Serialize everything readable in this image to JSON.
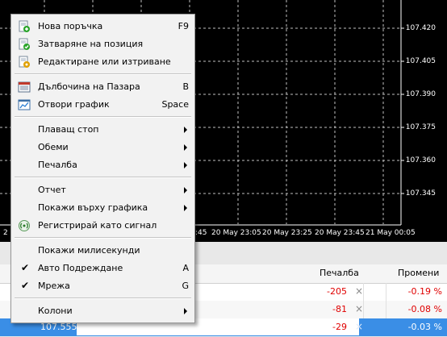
{
  "chart": {
    "prices": [
      "107.420",
      "107.405",
      "107.390",
      "107.375",
      "107.360",
      "107.345"
    ],
    "times": [
      "20 May 22:45",
      "20 May 23:05",
      "20 May 23:25",
      "20 May 23:45",
      "21 May 00:05"
    ],
    "time_prefix_fragments": [
      "2",
      ":45"
    ],
    "colors": {
      "background": "#000000",
      "grid": "#c0c0c0",
      "text": "#ffffff"
    }
  },
  "terminal": {
    "headers": {
      "profit": "Печалба",
      "change": "Промени"
    },
    "rows": [
      {
        "profit": "-205",
        "change": "-0.19 %",
        "price": ""
      },
      {
        "profit": "-81",
        "change": "-0.08 %",
        "price": ""
      },
      {
        "profit": "-29",
        "change": "-0.03 %",
        "price": "107.555"
      }
    ],
    "close_glyph": "×"
  },
  "menu": {
    "items": [
      {
        "label": "Нова поръчка",
        "shortcut": "F9"
      },
      {
        "label": "Затваряне на позиция",
        "shortcut": ""
      },
      {
        "label": "Редактиране или изтриване",
        "shortcut": ""
      },
      {
        "label": "Дълбочина на Пазара",
        "shortcut": "B"
      },
      {
        "label": "Отвори график",
        "shortcut": "Space"
      },
      {
        "label": "Плаващ стоп",
        "shortcut": ""
      },
      {
        "label": "Обеми",
        "shortcut": ""
      },
      {
        "label": "Печалба",
        "shortcut": ""
      },
      {
        "label": "Отчет",
        "shortcut": ""
      },
      {
        "label": "Покажи върху графика",
        "shortcut": ""
      },
      {
        "label": "Регистрирай като сигнал",
        "shortcut": ""
      },
      {
        "label": "Покажи милисекунди",
        "shortcut": ""
      },
      {
        "label": "Авто Подреждане",
        "shortcut": "A"
      },
      {
        "label": "Мрежа",
        "shortcut": "G"
      },
      {
        "label": "Колони",
        "shortcut": ""
      }
    ],
    "check_glyph": "✔"
  }
}
